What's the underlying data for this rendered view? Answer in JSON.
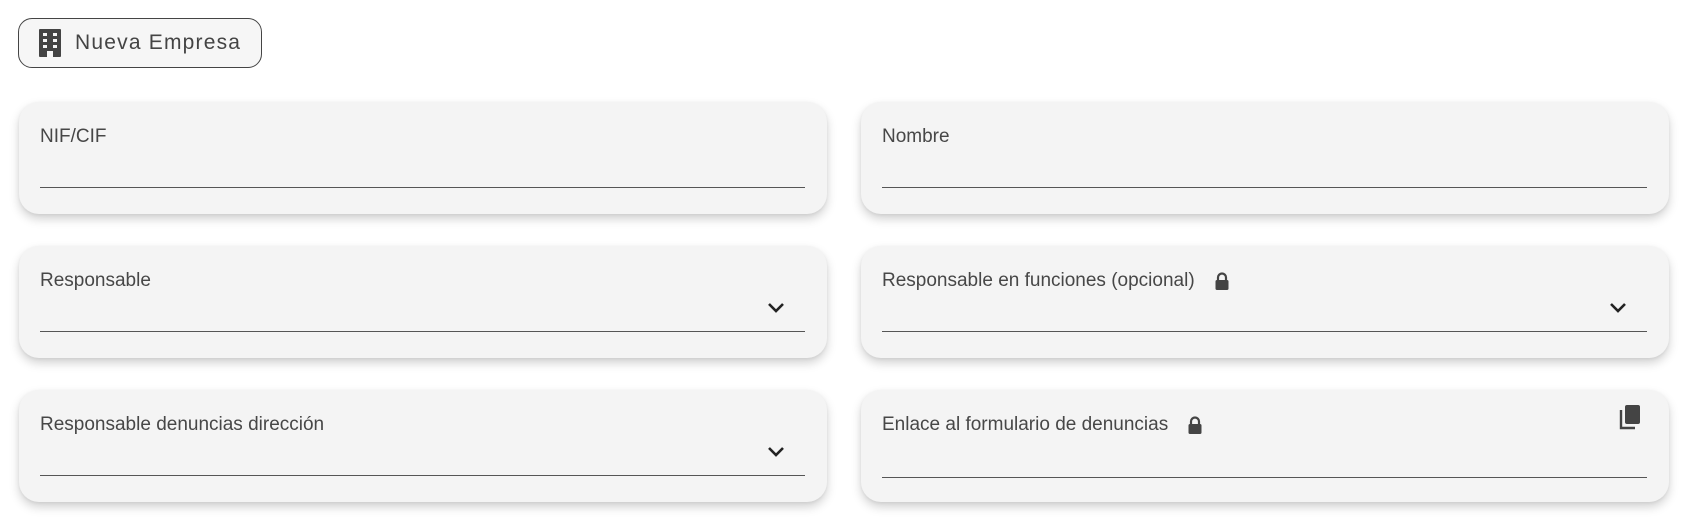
{
  "header": {
    "button_label": "Nueva Empresa",
    "icon": "building-icon"
  },
  "form": {
    "nif": {
      "label": "NIF/CIF",
      "value": ""
    },
    "nombre": {
      "label": "Nombre",
      "value": ""
    },
    "responsable": {
      "label": "Responsable",
      "value": "",
      "icon": "chevron-down-icon"
    },
    "responsable_funciones": {
      "label": "Responsable en funciones (opcional)",
      "value": "",
      "icons": [
        "lock-icon",
        "chevron-down-icon"
      ]
    },
    "responsable_denuncias": {
      "label": "Responsable denuncias dirección",
      "value": "",
      "icon": "chevron-down-icon"
    },
    "enlace_formulario": {
      "label": "Enlace al formulario de denuncias",
      "value": "",
      "icons": [
        "lock-icon",
        "copy-icon"
      ]
    }
  },
  "colors": {
    "card_bg": "#f4f4f4",
    "text": "#474747",
    "border": "#444444"
  }
}
